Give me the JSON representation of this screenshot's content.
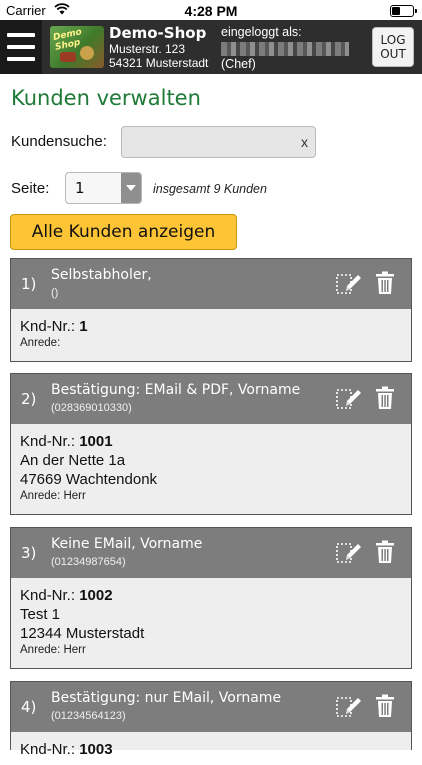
{
  "status": {
    "carrier": "Carrier",
    "time": "4:28 PM"
  },
  "header": {
    "shop_name": "Demo-Shop",
    "address_line1": "Musterstr. 123",
    "address_line2": "54321 Musterstadt",
    "login_label": "eingeloggt als:",
    "login_role": "(Chef)",
    "logout_line1": "LOG",
    "logout_line2": "OUT",
    "logo_text_1": "Demo",
    "logo_text_2": "Shop"
  },
  "page": {
    "title": "Kunden verwalten",
    "search_label": "Kundensuche:",
    "search_value": "",
    "search_clear": "x",
    "page_label": "Seite:",
    "page_value": "1",
    "total_text": "insgesamt 9 Kunden",
    "show_all_label": "Alle Kunden anzeigen"
  },
  "customers": [
    {
      "num": "1)",
      "name": "Selbstabholer,",
      "firstname": "",
      "phone": "()",
      "knd_label": "Knd-Nr.:",
      "knd_nr": "1",
      "street": "",
      "city": "",
      "salutation_label": "Anrede:",
      "salutation": ""
    },
    {
      "num": "2)",
      "name": "Bestätigung: EMail & PDF,",
      "firstname": " Vorname",
      "phone": "(028369010330)",
      "knd_label": "Knd-Nr.:",
      "knd_nr": "1001",
      "street": "An der Nette 1a",
      "city": "47669 Wachtendonk",
      "salutation_label": "Anrede:",
      "salutation": "Herr"
    },
    {
      "num": "3)",
      "name": "Keine EMail,",
      "firstname": " Vorname",
      "phone": "(01234987654)",
      "knd_label": "Knd-Nr.:",
      "knd_nr": "1002",
      "street": "Test 1",
      "city": "12344 Musterstadt",
      "salutation_label": "Anrede:",
      "salutation": "Herr"
    },
    {
      "num": "4)",
      "name": "Bestätigung: nur EMail,",
      "firstname": " Vorname",
      "phone": "(01234564123)",
      "knd_label": "Knd-Nr.:",
      "knd_nr": "1003",
      "street": "",
      "city": "",
      "salutation_label": "",
      "salutation": ""
    }
  ],
  "icons": {
    "menu": "hamburger-icon",
    "edit": "edit-pencil-icon",
    "delete": "trash-icon",
    "wifi": "wifi-icon",
    "battery": "battery-icon"
  },
  "colors": {
    "title_green": "#1e7a37",
    "button_yellow": "#fdc535",
    "header_dark": "#2e2e2e",
    "card_head_gray": "#7d7d7d"
  }
}
